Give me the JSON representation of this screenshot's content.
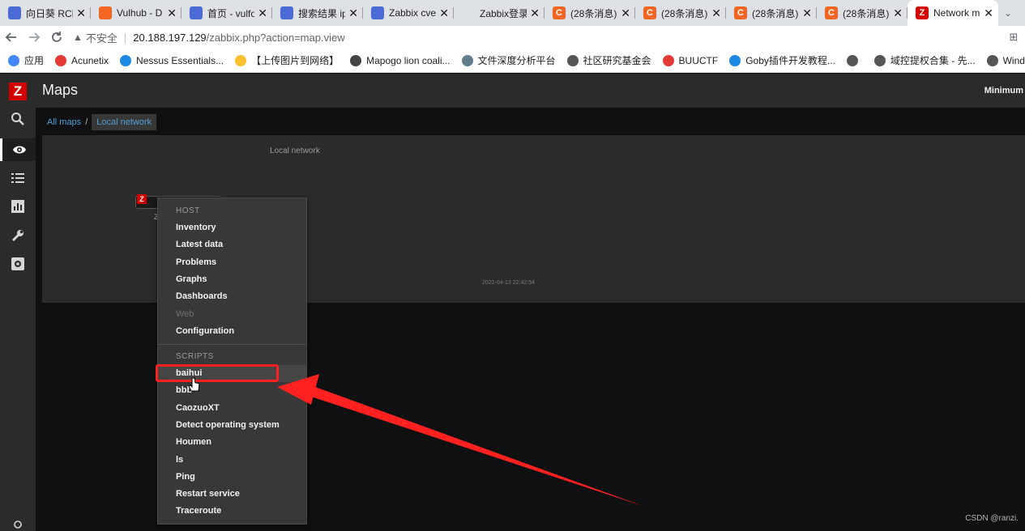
{
  "browser": {
    "tabs": [
      {
        "title": "向日葵 RCE",
        "favicon": "fav-blue",
        "glyph": ""
      },
      {
        "title": "Vulhub - D",
        "favicon": "fav-orange",
        "glyph": ""
      },
      {
        "title": "首页 - vulfo",
        "favicon": "fav-blue",
        "glyph": ""
      },
      {
        "title": "搜索结果 ip",
        "favicon": "fav-blue",
        "glyph": ""
      },
      {
        "title": "Zabbix cve",
        "favicon": "fav-blue",
        "glyph": ""
      },
      {
        "title": "Zabbix登录",
        "favicon": "fav-none",
        "glyph": ""
      },
      {
        "title": "(28条消息)",
        "favicon": "fav-orange",
        "glyph": "C"
      },
      {
        "title": "(28条消息)",
        "favicon": "fav-orange",
        "glyph": "C"
      },
      {
        "title": "(28条消息)",
        "favicon": "fav-orange",
        "glyph": "C"
      },
      {
        "title": "(28条消息)",
        "favicon": "fav-orange",
        "glyph": "C"
      },
      {
        "title": "Network m",
        "favicon": "fav-red",
        "glyph": "Z",
        "active": true
      }
    ],
    "close_glyph": "✕",
    "address": {
      "insecure_label": "不安全",
      "host": "20.188.197.129",
      "path": "/zabbix.php?action=map.view"
    },
    "bookmarks": [
      {
        "label": "应用",
        "color": "#4285f4"
      },
      {
        "label": "Acunetix",
        "color": "#e53935"
      },
      {
        "label": "Nessus Essentials...",
        "color": "#1e88e5"
      },
      {
        "label": "【上传图片到网络】",
        "color": "#fbc02d"
      },
      {
        "label": "Mapogo lion coali...",
        "color": "#444444"
      },
      {
        "label": "文件深度分析平台",
        "color": "#607d8b"
      },
      {
        "label": "社区研究基金会",
        "color": "#555555"
      },
      {
        "label": "BUUCTF",
        "color": "#e53935"
      },
      {
        "label": "Goby插件开发教程...",
        "color": "#1e88e5"
      },
      {
        "label": "",
        "color": "#555555"
      },
      {
        "label": "域控提权合集 - 先...",
        "color": "#555555"
      },
      {
        "label": "Windows内核提权",
        "color": "#555555"
      }
    ]
  },
  "zabbix": {
    "logo": "Z",
    "header_title": "Maps",
    "header_right": "Minimum",
    "breadcrumb": {
      "all_maps": "All maps",
      "separator": "/",
      "current": "Local network"
    },
    "map": {
      "label": "Local network",
      "timestamp": "2022-04-13 22:42:54",
      "host_label": "Z"
    },
    "context_menu": {
      "host_header": "HOST",
      "host_items": [
        {
          "label": "Inventory",
          "disabled": false
        },
        {
          "label": "Latest data",
          "disabled": false
        },
        {
          "label": "Problems",
          "disabled": false
        },
        {
          "label": "Graphs",
          "disabled": false
        },
        {
          "label": "Dashboards",
          "disabled": false
        },
        {
          "label": "Web",
          "disabled": true
        },
        {
          "label": "Configuration",
          "disabled": false
        }
      ],
      "scripts_header": "SCRIPTS",
      "script_items": [
        {
          "label": "baihui",
          "hover": true
        },
        {
          "label": "bbb"
        },
        {
          "label": "CaozuoXT"
        },
        {
          "label": "Detect operating system"
        },
        {
          "label": "Houmen"
        },
        {
          "label": "ls"
        },
        {
          "label": "Ping"
        },
        {
          "label": "Restart service"
        },
        {
          "label": "Traceroute"
        }
      ]
    }
  },
  "watermark": "CSDN @ranzi.",
  "colors": {
    "annotation_red": "#ff2020",
    "zabbix_red": "#d40000",
    "link_blue": "#4f9fd6"
  }
}
